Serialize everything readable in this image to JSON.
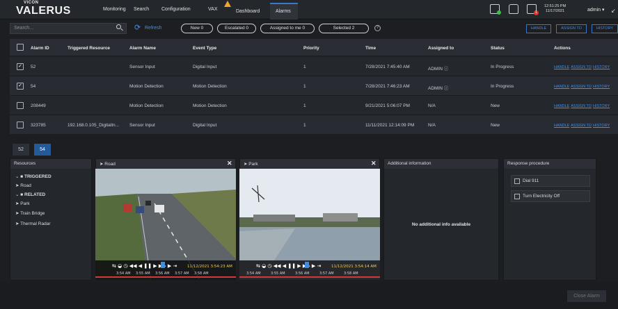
{
  "app": {
    "brand_small": "VICON",
    "brand": "VALERUS"
  },
  "nav": [
    "Monitoring",
    "Search",
    "Configuration",
    "VAX",
    "Dashboard",
    "Alarms"
  ],
  "clock": {
    "time": "12:51:25 PM",
    "date": "11/17/2021"
  },
  "user": "admin ▾",
  "toolbar": {
    "search_placeholder": "Search...",
    "refresh": "Refresh",
    "filters": [
      "New 0",
      "Escalated 0",
      "Assigned to me 0",
      "Selected 2"
    ],
    "buttons": [
      "HANDLE",
      "ASSIGN TO",
      "HISTORY"
    ]
  },
  "table": {
    "headers": [
      "Alarm ID",
      "Triggered Resource",
      "Alarm Name",
      "Event Type",
      "Priority",
      "Time",
      "Assigned to",
      "Status",
      "Actions"
    ],
    "rows": [
      {
        "checked": "✓",
        "id": "52",
        "resource": "",
        "name": "Sensor Input",
        "event": "Digital Input",
        "priority": "1",
        "time": "7/28/2021 7:45:40 AM",
        "assigned": "ADMIN ⓘ",
        "status": "In Progress"
      },
      {
        "checked": "✓",
        "id": "54",
        "resource": "",
        "name": "Motion Detection",
        "event": "Motion Detection",
        "priority": "1",
        "time": "7/28/2021 7:46:23 AM",
        "assigned": "ADMIN ⓘ",
        "status": "In Progress"
      },
      {
        "checked": "",
        "id": "208449",
        "resource": "",
        "name": "Motion Detection",
        "event": "Motion Detection",
        "priority": "1",
        "time": "9/21/2021 5:06:07 PM",
        "assigned": "N/A",
        "status": "New"
      },
      {
        "checked": "",
        "id": "323785",
        "resource": "192.168.0.105_DigitalIn...",
        "name": "Sensor Input",
        "event": "Digital Input",
        "priority": "1",
        "time": "11/11/2021 12:14:09 PM",
        "assigned": "N/A",
        "status": "New"
      }
    ],
    "actions": [
      "HANDLE",
      "ASSIGN TO",
      "HISTORY"
    ]
  },
  "alarm_tabs": [
    "52",
    "54"
  ],
  "resources": {
    "title": "Resources",
    "items": [
      {
        "label": "TRIGGERED",
        "kind": "folder"
      },
      {
        "label": "Road",
        "kind": "camera"
      },
      {
        "label": "RELATED",
        "kind": "folder"
      },
      {
        "label": "Park",
        "kind": "camera"
      },
      {
        "label": "Train Bridge",
        "kind": "camera"
      },
      {
        "label": "Thermal Radar",
        "kind": "camera"
      }
    ]
  },
  "videos": [
    {
      "title": "Road",
      "timestamp": "11/12/2021 3:54:23 AM",
      "ticks": [
        "3:54 AM",
        "3:55 AM",
        "3:56 AM",
        "3:57 AM",
        "3:58 AM"
      ]
    },
    {
      "title": "Park",
      "timestamp": "11/12/2021 3:54:14 AM",
      "ticks": [
        "3:54 AM",
        "3:55 AM",
        "3:56 AM",
        "3:57 AM",
        "3:58 AM"
      ]
    }
  ],
  "additional_info": {
    "title": "Additional information",
    "empty": "No additional info available"
  },
  "response": {
    "title": "Response procedure",
    "items": [
      "Dial 911",
      "Turn Electricity Off"
    ]
  },
  "close_alarm": "Close Alarm",
  "colors": {
    "accent": "#4a8de0",
    "warning": "#f0a52d",
    "danger": "#e0342b",
    "ok": "#3cc04a"
  }
}
